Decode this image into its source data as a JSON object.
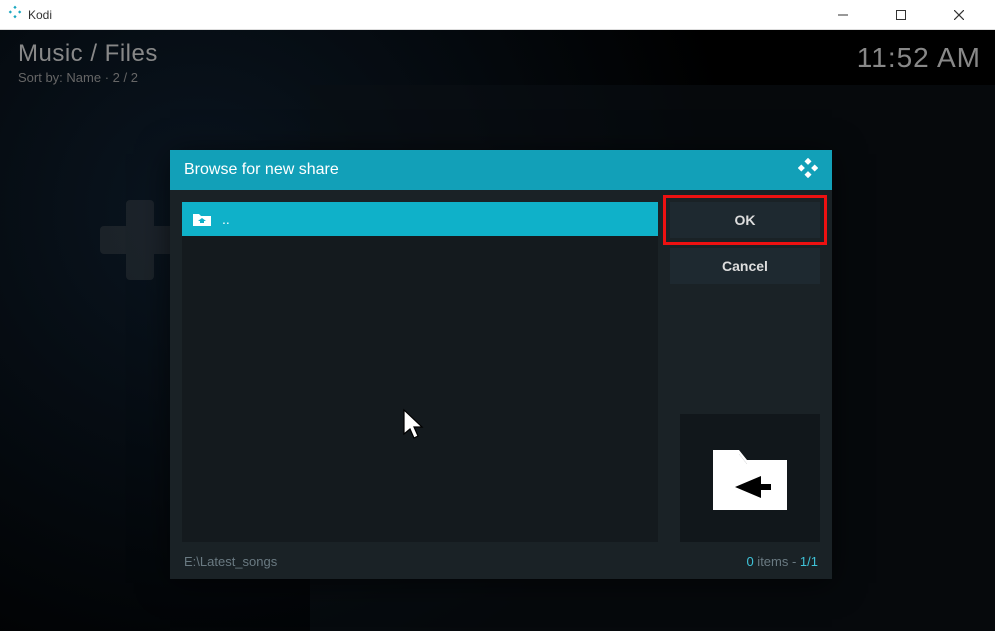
{
  "window": {
    "title": "Kodi"
  },
  "header": {
    "breadcrumb": "Music / Files",
    "sort_line": "Sort by: Name  ·  2 / 2",
    "clock": "11:52 AM"
  },
  "dialog": {
    "title": "Browse for new share",
    "list": {
      "items": [
        {
          "label": "..",
          "type": "up",
          "active": true
        }
      ]
    },
    "buttons": {
      "ok": "OK",
      "cancel": "Cancel"
    },
    "footer": {
      "path": "E:\\Latest_songs",
      "count_num": "0",
      "count_items_text": " items - ",
      "count_pos": "1/1"
    }
  }
}
